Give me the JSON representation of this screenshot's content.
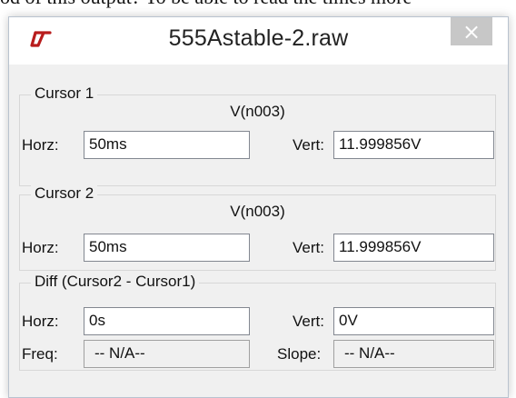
{
  "background_text": "od of this output?  To be able to read the times more",
  "window": {
    "title": "555Astable-2.raw",
    "close_symbol": "×",
    "icon": "ltspice-logo-icon"
  },
  "cursor1": {
    "legend": "Cursor 1",
    "trace": "V(n003)",
    "horz_label": "Horz:",
    "horz_value": "50ms",
    "vert_label": "Vert:",
    "vert_value": "11.999856V"
  },
  "cursor2": {
    "legend": "Cursor 2",
    "trace": "V(n003)",
    "horz_label": "Horz:",
    "horz_value": "50ms",
    "vert_label": "Vert:",
    "vert_value": "11.999856V"
  },
  "diff": {
    "legend": "Diff (Cursor2 - Cursor1)",
    "horz_label": "Horz:",
    "horz_value": "0s",
    "vert_label": "Vert:",
    "vert_value": "0V",
    "freq_label": "Freq:",
    "freq_value": "-- N/A--",
    "slope_label": "Slope:",
    "slope_value": "-- N/A--"
  },
  "colors": {
    "logo": "#b81c1c",
    "close_button": "#c7c7c7",
    "dialog_bg": "#f0f0f0"
  }
}
